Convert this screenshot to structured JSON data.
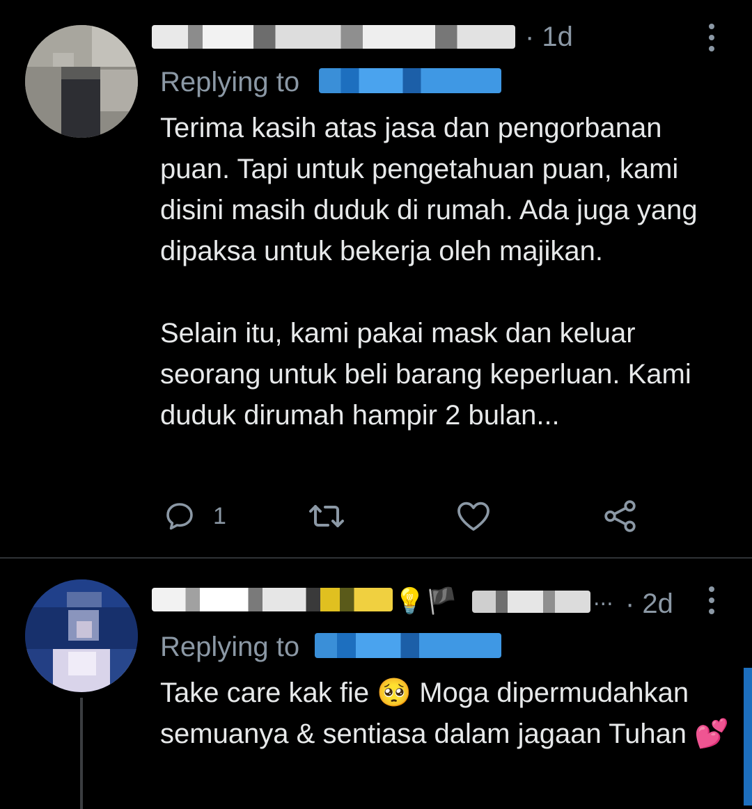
{
  "tweets": [
    {
      "timestamp": "· 1d",
      "replying_label": "Replying to",
      "body_paragraphs": [
        "Terima kasih atas jasa dan pengorbanan puan. Tapi untuk pengetahuan puan, kami disini masih duduk di rumah. Ada juga yang dipaksa untuk bekerja oleh majikan.",
        "Selain itu, kami pakai mask dan keluar seorang untuk beli barang keperluan. Kami duduk dirumah hampir 2 bulan..."
      ],
      "actions": {
        "reply_count": "1",
        "retweet_count": "",
        "like_count": ""
      }
    },
    {
      "timestamp": "· 2d",
      "name_suffix": "...",
      "name_emojis": [
        "💡",
        "🏴"
      ],
      "replying_label": "Replying to",
      "body_lines": [
        "Take care kak fie",
        "Moga dipermudahkan semuanya & sentiasa dalam jagaan Tuhan"
      ],
      "body_emojis": [
        "🥺",
        "💕"
      ]
    }
  ],
  "colors": {
    "background": "#000000",
    "text_primary": "#e7e9ea",
    "text_secondary": "#8b98a5",
    "divider": "#2f3336",
    "accent": "#1d9bf0"
  },
  "icons": {
    "reply": "reply-icon",
    "retweet": "retweet-icon",
    "like": "like-icon",
    "share": "share-icon",
    "more": "more-icon"
  }
}
